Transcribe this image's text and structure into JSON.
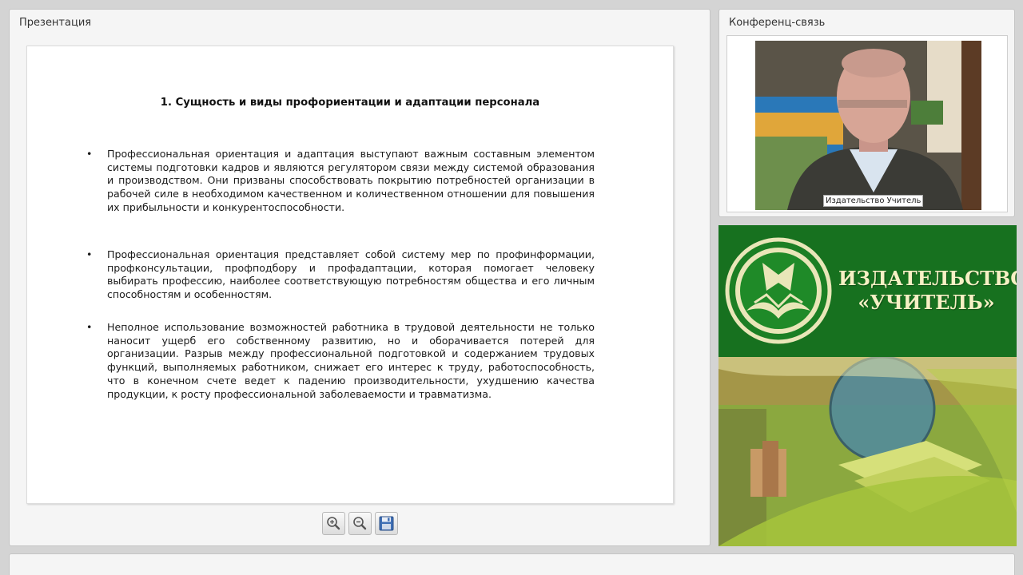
{
  "presentation": {
    "title": "Презентация",
    "slide": {
      "heading": "1. Сущность и виды профориентации и адаптации персонала",
      "bullets": [
        "Профессиональная ориентация и адаптация выступают важным составным элементом системы подготовки кадров и являются регулятором связи между системой образования и производством. Они призваны способствовать покрытию потребностей организации в рабочей силе в необходимом качественном и количественном отношении для повышения их прибыльности и конкурентоспособности.",
        "Профессиональная ориентация представляет собой систему мер по профинформации, профконсультации, профподбору и профадаптации, которая помогает человеку выбирать профессию, наиболее соответствующую потребностям общества и его личным способностям и особенностям.",
        "Неполное использование возможностей работника в трудовой деятельности не только наносит ущерб его собственному развитию, но и оборачивается потерей для организации. Разрыв между профессиональной подготовкой и содержанием трудовых функций, выполняемых работником, снижает его интерес к труду, работоспособность, что в конечном счете ведет к падению производительности, ухудшению качества продукции, к росту профессиональной заболеваемости и травматизма."
      ]
    },
    "toolbar": {
      "zoom_in_icon": "zoom-in-icon",
      "zoom_out_icon": "zoom-out-icon",
      "save_icon": "floppy-disk-icon"
    }
  },
  "conference": {
    "title": "Конференц-связь",
    "participant_name": "Издательство Учитель"
  },
  "banner": {
    "line1": "ИЗДАТЕЛЬСТВО",
    "line2": "«УЧИТЕЛЬ»",
    "brand_green": "#17711f",
    "brand_cream": "#f6f0c4"
  }
}
